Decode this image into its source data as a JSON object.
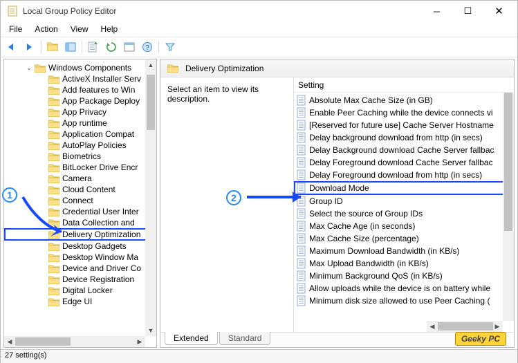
{
  "window": {
    "title": "Local Group Policy Editor"
  },
  "menu": {
    "file": "File",
    "action": "Action",
    "view": "View",
    "help": "Help"
  },
  "tree": {
    "root": "Windows Components",
    "items": [
      "ActiveX Installer Serv",
      "Add features to Win",
      "App Package Deploy",
      "App Privacy",
      "App runtime",
      "Application Compat",
      "AutoPlay Policies",
      "Biometrics",
      "BitLocker Drive Encr",
      "Camera",
      "Cloud Content",
      "Connect",
      "Credential User Inter",
      "Data Collection and",
      "Delivery Optimization",
      "Desktop Gadgets",
      "Desktop Window Ma",
      "Device and Driver Co",
      "Device Registration",
      "Digital Locker",
      "Edge UI"
    ],
    "selected_index": 14
  },
  "details": {
    "header": "Delivery Optimization",
    "hint": "Select an item to view its description.",
    "col_header": "Setting",
    "settings": [
      "Absolute Max Cache Size (in GB)",
      "Enable Peer Caching while the device connects vi",
      "[Reserved for future use] Cache Server Hostname",
      "Delay background download from http (in secs)",
      "Delay Background download Cache Server fallbac",
      "Delay Foreground download Cache Server fallbac",
      "Delay Foreground download from http (in secs)",
      "Download Mode",
      "Group ID",
      "Select the source of Group IDs",
      "Max Cache Age (in seconds)",
      "Max Cache Size (percentage)",
      "Maximum Download Bandwidth (in KB/s)",
      "Max Upload Bandwidth (in KB/s)",
      "Minimum Background QoS (in KB/s)",
      "Allow uploads while the device is on battery while",
      "Minimum disk size allowed to use Peer Caching ("
    ],
    "selected_index": 7
  },
  "tabs": {
    "extended": "Extended",
    "standard": "Standard"
  },
  "status": "27 setting(s)",
  "watermark": "Geeky PC",
  "annotations": {
    "b1": "1",
    "b2": "2"
  }
}
